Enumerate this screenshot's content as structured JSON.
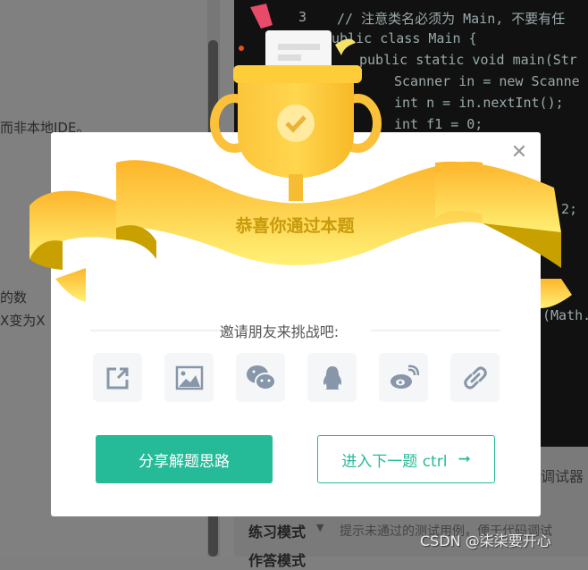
{
  "left_panel": {
    "lines": [
      "而非本地IDE。",
      "的数",
      "X变为X"
    ]
  },
  "editor": {
    "line_number": "3",
    "lines": [
      {
        "t": "// 注意类名必须为 Main, 不要有任",
        "c": "cmt"
      },
      {
        "t": "public class Main {",
        "c": "kw"
      },
      {
        "t": "public static void main(Str",
        "c": "kw"
      },
      {
        "t": "Scanner in = new Scanne",
        "c": "ty"
      },
      {
        "t": "int n = in.nextInt();",
        "c": "ty"
      },
      {
        "t": "int f1 = 0;",
        "c": "ty"
      }
    ],
    "frag1": "2;",
    "frag2": "(Math."
  },
  "bottom": {
    "debugger": "调试器",
    "mode": "练习模式",
    "mode_hint": "提示未通过的测试用例，便于代码调试",
    "cut": "作答模式"
  },
  "modal": {
    "title": "恭喜你通过本题",
    "invite": "邀请朋友来挑战吧:",
    "share_icons": [
      "share-external-icon",
      "image-icon",
      "wechat-icon",
      "qq-icon",
      "weibo-icon",
      "link-icon"
    ],
    "share_button": "分享解题思路",
    "next_button": "进入下一题 ctrl",
    "accent": "#26bb98"
  },
  "watermark": "CSDN @柒柒要开心"
}
